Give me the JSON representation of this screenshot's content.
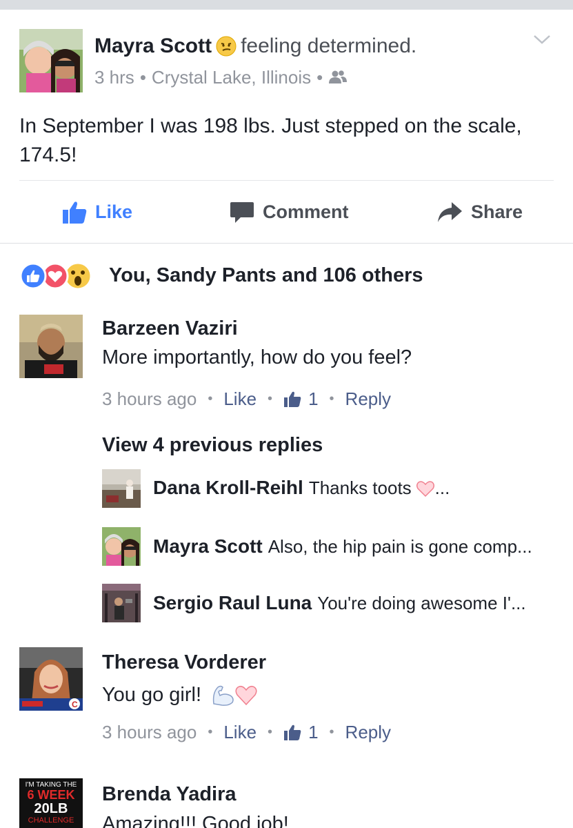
{
  "post": {
    "author": "Mayra Scott",
    "feeling": "feeling determined.",
    "time": "3 hrs",
    "location": "Crystal Lake, Illinois",
    "privacy_icon": "friends-icon",
    "text": "In September I was 198 lbs. Just stepped on the scale, 174.5!"
  },
  "actions": {
    "like": "Like",
    "comment": "Comment",
    "share": "Share"
  },
  "reactions": {
    "icons": [
      "like-reaction-icon",
      "love-reaction-icon",
      "wow-reaction-icon"
    ],
    "summary": "You, Sandy Pants and 106 others"
  },
  "comments": [
    {
      "name": "Barzeen Vaziri",
      "text": "More importantly, how do you feel?",
      "time": "3 hours ago",
      "like": "Like",
      "likes": "1",
      "reply": "Reply"
    },
    {
      "name": "Theresa Vorderer",
      "text": "You go girl!",
      "time": "3 hours ago",
      "like": "Like",
      "likes": "1",
      "reply": "Reply"
    },
    {
      "name": "Brenda Yadira",
      "text": "Amazing!!! Good job!",
      "avatar_text": [
        "I'M TAKING THE",
        "6 WEEK",
        "20LB",
        "CHALLENGE"
      ]
    }
  ],
  "view_replies": "View 4 previous replies",
  "replies": [
    {
      "name": "Dana Kroll-Reihl",
      "text": "Thanks toots",
      "suffix": "..."
    },
    {
      "name": "Mayra Scott",
      "text": "Also, the hip pain is gone comp..."
    },
    {
      "name": "Sergio Raul Luna",
      "text": "You're doing awesome I'..."
    }
  ],
  "colors": {
    "link_blue": "#4080ff",
    "meta_gray": "#90949c",
    "text_dark": "#1d2129",
    "reply_link": "#4b5d8a"
  }
}
